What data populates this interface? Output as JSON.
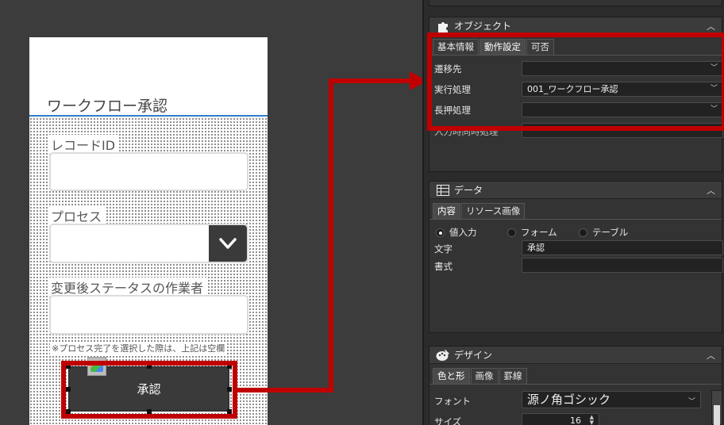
{
  "phone": {
    "title": "ワークフロー承認",
    "fields": [
      {
        "label": "レコードID",
        "value": ""
      },
      {
        "label": "プロセス",
        "value": ""
      },
      {
        "label": "変更後ステータスの作業者",
        "value": ""
      }
    ],
    "note": "※プロセス完了を選択した際は、上記は空欄",
    "approve_button": "承認"
  },
  "object_panel": {
    "title": "オブジェクト",
    "tabs": [
      "基本情報",
      "動作設定",
      "可否"
    ],
    "active_tab": "動作設定",
    "rows": [
      {
        "label": "遷移先",
        "value": ""
      },
      {
        "label": "実行処理",
        "value": "001_ワークフロー承認"
      },
      {
        "label": "長押処理",
        "value": ""
      },
      {
        "label": "入力時同時処理",
        "value": ""
      }
    ]
  },
  "data_panel": {
    "title": "データ",
    "tabs": [
      "内容",
      "リソース画像"
    ],
    "active_tab": "内容",
    "radios": [
      {
        "label": "値入力",
        "selected": true
      },
      {
        "label": "フォーム",
        "selected": false
      },
      {
        "label": "テーブル",
        "selected": false
      }
    ],
    "rows": [
      {
        "label": "文字",
        "value": "承認"
      },
      {
        "label": "書式",
        "value": ""
      }
    ]
  },
  "design_panel": {
    "title": "デザイン",
    "tabs": [
      "色と形",
      "画像",
      "罫線"
    ],
    "active_tab": "色と形",
    "font_label": "フォント",
    "font_value": "源ノ角ゴシック",
    "size_label": "サイズ",
    "size_value": "16"
  },
  "colors": {
    "highlight": "#c00000",
    "title_underline": "#2f7fc9",
    "button_dark": "#3a3a3a"
  }
}
